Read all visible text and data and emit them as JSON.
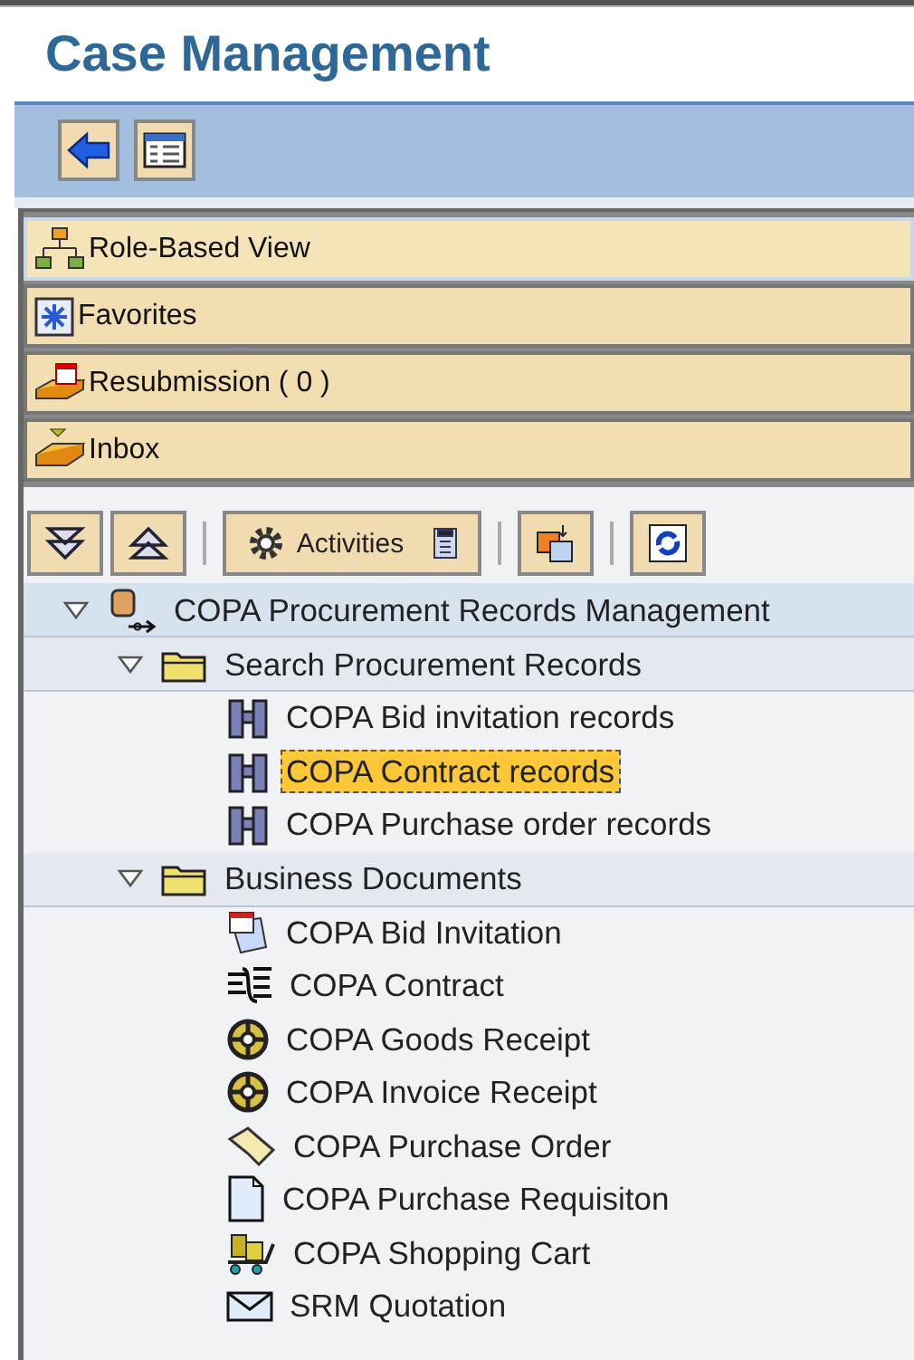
{
  "header": {
    "title": "Case Management"
  },
  "nav_toolbar": {
    "buttons": [
      {
        "kind": "back"
      },
      {
        "kind": "layout"
      }
    ]
  },
  "nav_items": [
    {
      "kind": "roles",
      "label": "Role-Based View",
      "selected": true
    },
    {
      "kind": "favorites",
      "label": "Favorites",
      "selected": false
    },
    {
      "kind": "resubmission",
      "label": "Resubmission ( 0  )",
      "selected": false
    },
    {
      "kind": "inbox",
      "label": "Inbox",
      "selected": false
    }
  ],
  "tree_toolbar": {
    "activities_label": "Activities"
  },
  "tree": {
    "label": "COPA Procurement Records Management",
    "kind": "role",
    "expanded": true,
    "children": [
      {
        "label": "Search Procurement Records",
        "kind": "folder",
        "expanded": true,
        "children": [
          {
            "label": "COPA Bid invitation records",
            "kind": "search",
            "selected": false
          },
          {
            "label": "COPA Contract records",
            "kind": "search",
            "selected": true
          },
          {
            "label": "COPA Purchase order records",
            "kind": "search",
            "selected": false
          }
        ]
      },
      {
        "label": "Business Documents",
        "kind": "folder",
        "expanded": true,
        "children": [
          {
            "label": "COPA Bid Invitation",
            "kind": "calendar",
            "selected": false
          },
          {
            "label": "COPA Contract",
            "kind": "contract",
            "selected": false
          },
          {
            "label": "COPA Goods Receipt",
            "kind": "wheel",
            "selected": false
          },
          {
            "label": "COPA Invoice Receipt",
            "kind": "wheel",
            "selected": false
          },
          {
            "label": "COPA Purchase Order",
            "kind": "scroll",
            "selected": false
          },
          {
            "label": "COPA Purchase Requisiton",
            "kind": "page",
            "selected": false
          },
          {
            "label": "COPA Shopping Cart",
            "kind": "cart",
            "selected": false
          },
          {
            "label": "SRM Quotation",
            "kind": "envelope",
            "selected": false
          }
        ]
      }
    ]
  }
}
